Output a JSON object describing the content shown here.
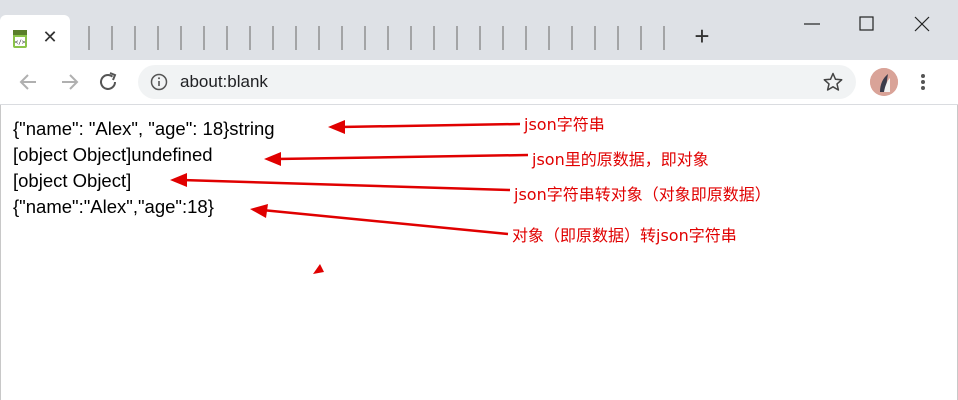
{
  "browser": {
    "tab_close_glyph": "✕",
    "new_tab_glyph": "+",
    "url": "about:blank",
    "icons": {
      "favicon": "html-file-icon",
      "back": "back-arrow-icon",
      "forward": "forward-arrow-icon",
      "reload": "reload-icon",
      "info": "info-icon",
      "bookmark": "star-icon",
      "profile": "avatar",
      "menu": "menu-dots-icon"
    }
  },
  "console_output": [
    "{\"name\": \"Alex\", \"age\": 18}string",
    "[object Object]undefined",
    "[object Object]",
    "{\"name\":\"Alex\",\"age\":18}"
  ],
  "annotations": [
    "json字符串",
    "json里的原数据，即对象",
    "json字符串转对象（对象即原数据）",
    "对象（即原数据）转json字符串"
  ],
  "colors": {
    "annotation": "#e00000",
    "tabstrip": "#dee1e6",
    "omnibox": "#f1f3f4"
  }
}
